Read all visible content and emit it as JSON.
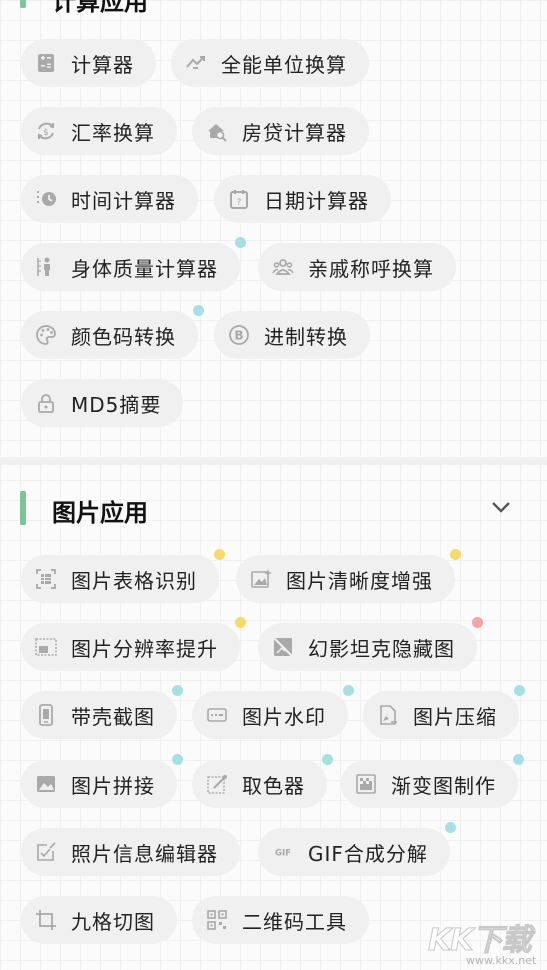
{
  "section_top": {
    "title": "计算应用",
    "items": [
      {
        "label": "计算器",
        "icon": "calculator-icon"
      },
      {
        "label": "全能单位换算",
        "icon": "trend-arrows-icon"
      },
      {
        "label": "汇率换算",
        "icon": "currency-exchange-icon"
      },
      {
        "label": "房贷计算器",
        "icon": "house-search-icon"
      },
      {
        "label": "时间计算器",
        "icon": "clock-icon"
      },
      {
        "label": "日期计算器",
        "icon": "calendar-icon"
      },
      {
        "label": "身体质量计算器",
        "icon": "body-ruler-icon",
        "dot": "#a6dfe4"
      },
      {
        "label": "亲戚称呼换算",
        "icon": "people-icon"
      },
      {
        "label": "颜色码转换",
        "icon": "palette-icon",
        "dot": "#a6dfe4"
      },
      {
        "label": "进制转换",
        "icon": "binary-b-icon"
      },
      {
        "label": "MD5摘要",
        "icon": "lock-icon"
      }
    ]
  },
  "section_image": {
    "title": "图片应用",
    "collapse_icon": "chevron-down-icon",
    "items": [
      {
        "label": "图片表格识别",
        "icon": "table-scan-icon",
        "dot": "#f6da6a"
      },
      {
        "label": "图片清晰度增强",
        "icon": "image-sparkle-icon",
        "dot": "#f6da6a"
      },
      {
        "label": "图片分辨率提升",
        "icon": "image-frame-icon",
        "dot": "#f6da6a"
      },
      {
        "label": "幻影坦克隐藏图",
        "icon": "image-hidden-icon",
        "dot": "#f4a4a4"
      },
      {
        "label": "带壳截图",
        "icon": "phone-frame-icon",
        "dot": "#a6dfe4"
      },
      {
        "label": "图片水印",
        "icon": "watermark-icon",
        "dot": "#a6dfe4"
      },
      {
        "label": "图片压缩",
        "icon": "image-compress-icon",
        "dot": "#a6dfe4"
      },
      {
        "label": "图片拼接",
        "icon": "image-icon",
        "dot": "#a6dfe4"
      },
      {
        "label": "取色器",
        "icon": "eyedropper-icon",
        "dot": "#a6dfe4"
      },
      {
        "label": "渐变图制作",
        "icon": "gradient-icon",
        "dot": "#a6dfe4"
      },
      {
        "label": "照片信息编辑器",
        "icon": "photo-edit-icon",
        "dot": "#a6dfe4"
      },
      {
        "label": "GIF合成分解",
        "icon": "gif-icon",
        "icon_text": "GIF",
        "dot": "#a6dfe4"
      },
      {
        "label": "九格切图",
        "icon": "crop-icon"
      },
      {
        "label": "二维码工具",
        "icon": "qr-code-icon"
      }
    ]
  },
  "watermark": {
    "logo": "KK下载",
    "url": "www.kkx.net"
  },
  "colors": {
    "accent_bar": "#7cc49a",
    "chip_bg": "#f0f0f0",
    "icon_gray": "#a9a9a9"
  }
}
